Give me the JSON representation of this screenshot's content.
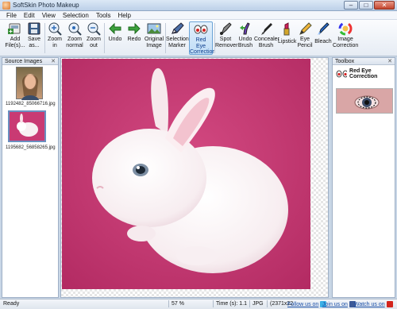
{
  "window": {
    "title": "SoftSkin Photo Makeup"
  },
  "menu": [
    "File",
    "Edit",
    "View",
    "Selection",
    "Tools",
    "Help"
  ],
  "toolbar": {
    "add": "Add\nFile(s)...",
    "save": "Save\nas...",
    "zoom_in": "Zoom\nin",
    "zoom_normal": "Zoom\nnormal",
    "zoom_out": "Zoom\nout",
    "undo": "Undo",
    "redo": "Redo",
    "original": "Original\nImage",
    "selection_marker": "Selection\nMarker",
    "red_eye": "Red\nEye\nCorrection",
    "spot_remover": "Spot\nRemover",
    "undo_brush": "Undo\nBrush",
    "concealer_brush": "Concealer\nBrush",
    "lipstick": "Lipstick",
    "eye_pencil": "Eye\nPencil",
    "bleach": "Bleach",
    "image_correction": "Image\nCorrection"
  },
  "left_panel": {
    "title": "Source Images",
    "images": [
      {
        "caption": "1192482_85066716.jpg"
      },
      {
        "caption": "1195682_56858265.jpg"
      }
    ]
  },
  "right_panel": {
    "title": "Toolbox",
    "tool_name": "Red Eye Correction"
  },
  "status": {
    "state": "Ready",
    "zoom": "57 %",
    "time": "Time (s): 1.1",
    "format": "JPG",
    "dims": "(2371x22",
    "follow": "Follow us on",
    "join": "Join us on",
    "watch": "Watch us on"
  },
  "colors": {
    "accent": "#6ba3d6",
    "background_magenta": "#c4366f",
    "link": "#1b4fa8"
  }
}
